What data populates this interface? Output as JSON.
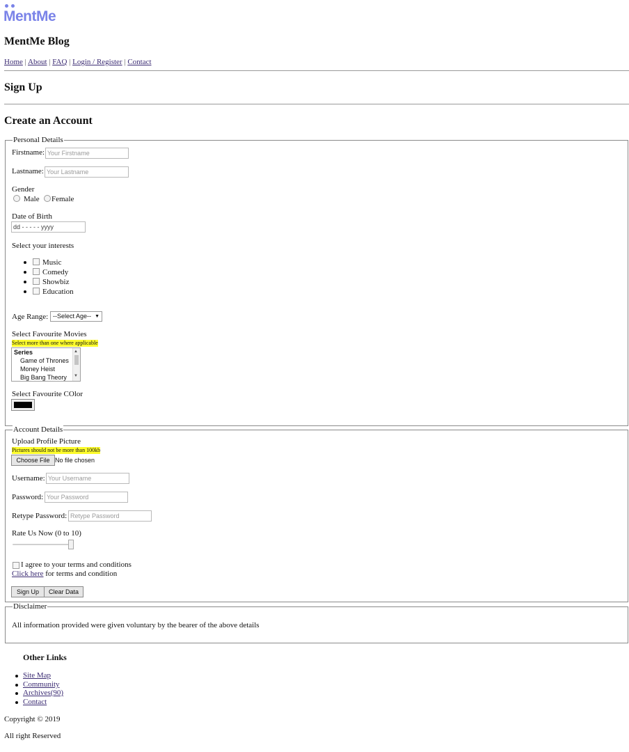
{
  "logo": {
    "text": "MentMe",
    "color": "#7a83e8"
  },
  "blog_title": "MentMe Blog",
  "nav": {
    "items": [
      "Home",
      "About",
      "FAQ",
      "Login / Register",
      "Contact"
    ],
    "separator": "|"
  },
  "page_title": "Sign Up",
  "section_title": "Create an Account",
  "personal": {
    "legend": "Personal Details",
    "firstname_label": "Firstname:",
    "firstname_placeholder": "Your Firstname",
    "lastname_label": "Lastname:",
    "lastname_placeholder": "Your Lastname",
    "gender_label": "Gender",
    "gender_options": [
      "Male",
      "Female"
    ],
    "dob_label": "Date of Birth",
    "dob_value": "dd - - - - - yyyy",
    "interests_label": "Select your interests",
    "interests": [
      "Music",
      "Comedy",
      "Showbiz",
      "Education"
    ],
    "age_label": "Age Range:",
    "age_selected": "--Select Age--",
    "movies_label": "Select Favourite Movies",
    "movies_hint": "Select more than one where applicable",
    "movies_group": "Series",
    "movies_options": [
      "Game of Thrones",
      "Money Heist",
      "Big Bang Theory"
    ],
    "color_label": "Select Favourite COlor",
    "color_value": "#000000"
  },
  "account": {
    "legend": "Account Details",
    "upload_label": "Upload Profile Picture",
    "upload_hint": "Pictures should not be more than 100kb",
    "choose_file": "Choose File",
    "no_file": "No file chosen",
    "username_label": "Username:",
    "username_placeholder": "Your Username",
    "password_label": "Password:",
    "password_placeholder": "Your Password",
    "retype_label": "Retype Password:",
    "retype_placeholder": "Retype Password",
    "rate_label": "Rate Us Now (0 to 10)",
    "rate_value_fraction": 1.0,
    "agree_label": "I agree to your terms and conditions",
    "click_here": "Click here",
    "terms_rest": " for terms and condition",
    "signup_button": "Sign Up",
    "clear_button": "Clear Data"
  },
  "disclaimer": {
    "legend": "Disclaimer",
    "text": "All information provided were given voluntary by the bearer of the above details"
  },
  "footer": {
    "other_links_title": "Other Links",
    "links": [
      "Site Map",
      "Community",
      "Archives(90)",
      "Contact"
    ],
    "copyright": "Copyright © 2019",
    "rights": "All right Reserved"
  },
  "colors": {
    "highlight": "#fdfc2c",
    "link": "#3a2a72"
  }
}
